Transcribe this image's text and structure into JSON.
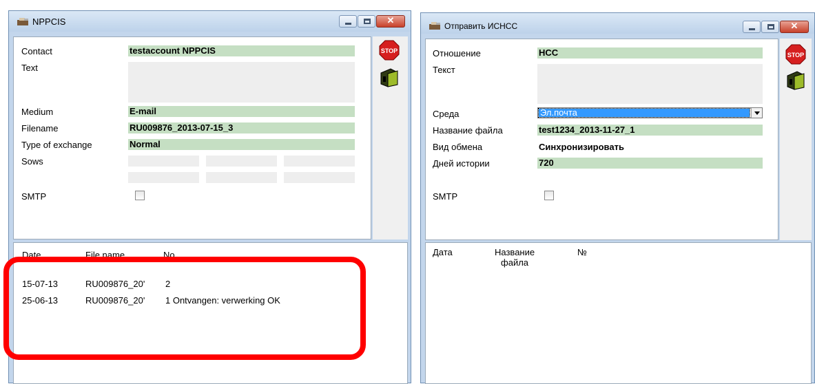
{
  "left_window": {
    "title": "NPPCIS",
    "labels": {
      "contact": "Contact",
      "text": "Text",
      "medium": "Medium",
      "filename": "Filename",
      "type_of_exchange": "Type of exchange",
      "sows": "Sows",
      "smtp": "SMTP"
    },
    "values": {
      "contact": "testaccount NPPCIS",
      "text": "",
      "medium": "E-mail",
      "filename": "RU009876_2013-07-15_3",
      "type_of_exchange": "Normal"
    },
    "smtp_checked": false,
    "list_headers": {
      "date": "Date",
      "file_name": "File name",
      "no": "No."
    },
    "rows": [
      {
        "date": "15-07-13",
        "file": "RU009876_20'",
        "no": "2"
      },
      {
        "date": "25-06-13",
        "file": "RU009876_20'",
        "no": "1 Ontvangen: verwerking OK"
      }
    ]
  },
  "right_window": {
    "title": "Отправить ИСНСС",
    "labels": {
      "relation": "Отношение",
      "text": "Текст",
      "medium": "Среда",
      "file_name": "Название файла",
      "exchange_type": "Вид обмена",
      "history_days": "Дней истории",
      "smtp": "SMTP"
    },
    "values": {
      "relation": "НСС",
      "text": "",
      "medium": "Эл.почта",
      "file_name": "test1234_2013-11-27_1",
      "exchange_type": "Синхронизировать",
      "history_days": "720"
    },
    "smtp_checked": false,
    "list_headers": {
      "date": "Дата",
      "file_name": "Название\nфайла",
      "no": "№"
    }
  },
  "buttons": {
    "stop_label": "STOP"
  },
  "colors": {
    "field_green": "#c5dfc3",
    "highlight_red": "#ff0000",
    "window_frame": "#c3d6ec"
  }
}
